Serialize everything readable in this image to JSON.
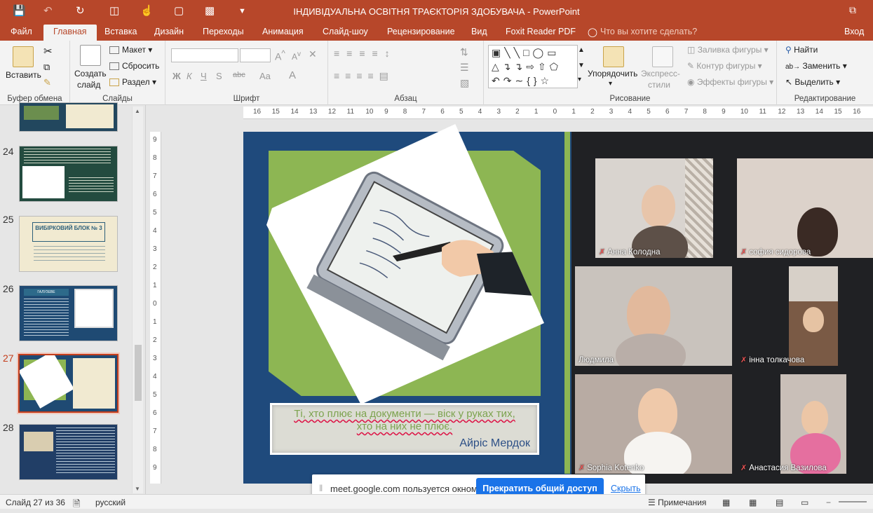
{
  "titlebar": {
    "title": "ІНДИВІДУАЛЬНА ОСВІТНЯ ТРАЄКТОРІЯ ЗДОБУВАЧА - PowerPoint",
    "restore_glyph": "⧉"
  },
  "tabs": [
    "Файл",
    "Главная",
    "Вставка",
    "Дизайн",
    "Переходы",
    "Анимация",
    "Слайд-шоу",
    "Рецензирование",
    "Вид",
    "Foxit Reader PDF",
    "Что вы хотите сделать?",
    "Вход"
  ],
  "ribbon": {
    "clipboard": {
      "paste": "Вставить",
      "label": "Буфер обмена"
    },
    "slides": {
      "new_slide_1": "Создать",
      "new_slide_2": "слайд",
      "layout": "Макет",
      "reset": "Сбросить",
      "section": "Раздел",
      "label": "Слайды"
    },
    "font": {
      "label": "Шрифт",
      "bold": "Ж",
      "italic": "К",
      "underline": "Ч",
      "strike": "S",
      "spacing": "abc",
      "case": "Aa",
      "grow": "A",
      "shrink": "A"
    },
    "paragraph": {
      "label": "Абзац"
    },
    "drawing": {
      "arrange_1": "Упорядочить",
      "styles_1": "Экспресс-",
      "styles_2": "стили",
      "fill": "Заливка фигуры",
      "outline": "Контур фигуры",
      "effects": "Эффекты фигуры",
      "label": "Рисование"
    },
    "editing": {
      "find": "Найти",
      "replace": "Заменить",
      "select": "Выделить",
      "label": "Редактирование"
    }
  },
  "slides_panel": {
    "numbers": [
      "24",
      "25",
      "26",
      "27",
      "28"
    ],
    "thumb25_title": "ВИБІРКОВИЙ БЛОК № 3",
    "thumb26_title": "ГАЛУЗЕВЕ ДОКУМЕНТОЗНАВСТВО"
  },
  "ruler": {
    "h_ticks": [
      "16",
      "15",
      "14",
      "13",
      "12",
      "11",
      "10",
      "9",
      "8",
      "7",
      "6",
      "5",
      "4",
      "3",
      "2",
      "1",
      "0",
      "1",
      "2",
      "3",
      "4",
      "5",
      "6",
      "7",
      "8",
      "9",
      "10",
      "11",
      "12",
      "13",
      "14",
      "15",
      "16"
    ],
    "v_ticks": [
      "9",
      "8",
      "7",
      "6",
      "5",
      "4",
      "3",
      "2",
      "1",
      "0",
      "1",
      "2",
      "3",
      "4",
      "5",
      "6",
      "7",
      "8",
      "9"
    ]
  },
  "slide": {
    "quote_line1": "Ті, хто плює на документи — віск у руках тих,",
    "quote_line2": "хто на них не плює.",
    "author": "Айріс Мердок"
  },
  "meet": {
    "participants": [
      {
        "name": "Анна Колодна",
        "muted": true
      },
      {
        "name": "софия сидорова",
        "muted": true
      },
      {
        "name": "Людмила",
        "muted": false
      },
      {
        "name": "інна толкачова",
        "muted": true
      },
      {
        "name": "Sophia Kotenko",
        "muted": true
      },
      {
        "name": "Анастасия Вазилова",
        "muted": true
      }
    ],
    "share_text": "meet.google.com пользуется окном.",
    "stop_button": "Прекратить общий доступ",
    "hide_link": "Скрыть"
  },
  "status": {
    "slide_count": "Слайд 27 из 36",
    "language": "русский",
    "notes": "Примечания"
  },
  "colors": {
    "brand": "#b7472a",
    "slide_bg": "#1f4a7c",
    "slide_green": "#8db653",
    "meet_bg": "#202124",
    "stop_button": "#1a73e8"
  }
}
